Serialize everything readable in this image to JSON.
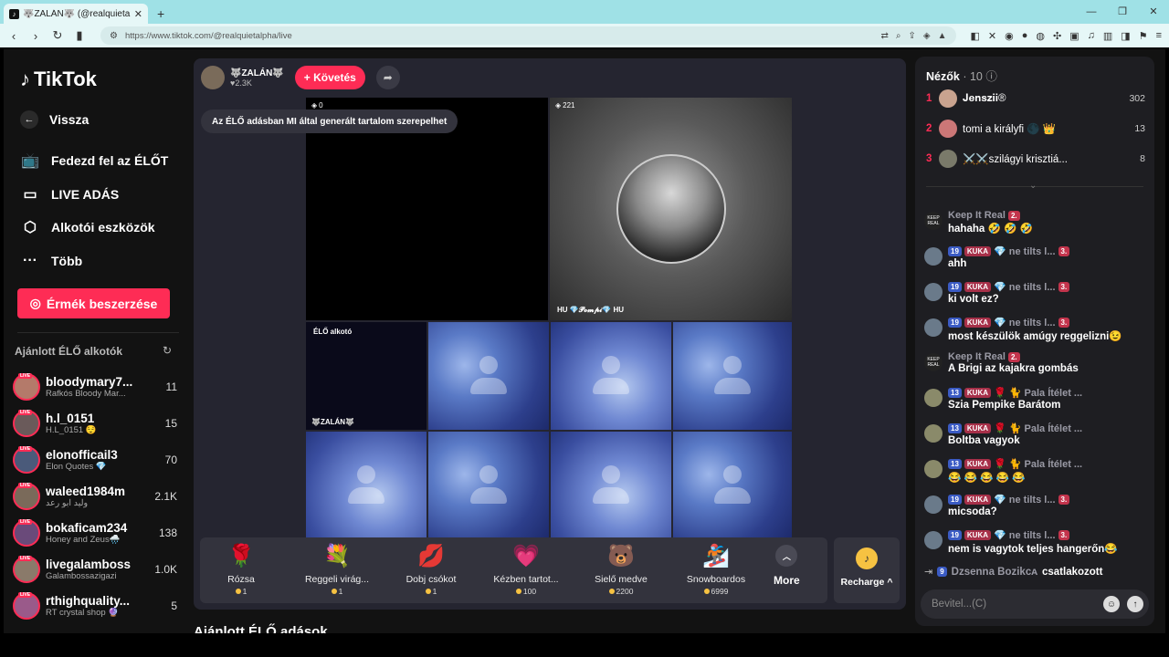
{
  "browser": {
    "tab_title": "🐺ZALÁN🐺 (@realquietalp",
    "url": "https://www.tiktok.com/@realquietalpha/live"
  },
  "sidebar": {
    "logo": "TikTok",
    "back": "Vissza",
    "nav": [
      {
        "label": "Fedezd fel az ÉLŐT",
        "icon": "tv-icon"
      },
      {
        "label": "LIVE ADÁS",
        "icon": "camera-icon"
      },
      {
        "label": "Alkotói eszközök",
        "icon": "creator-tools-icon"
      },
      {
        "label": "Több",
        "icon": "more-dots-icon"
      }
    ],
    "coins_button": "Érmék beszerzése",
    "suggested_title": "Ajánlott ÉLŐ alkotók",
    "live_tag": "LIVE",
    "creators": [
      {
        "username": "bloodymary7...",
        "sub": "Rafkós Bloody Mar...",
        "count": "11"
      },
      {
        "username": "h.l_0151",
        "sub": "H.L_0151 😌",
        "count": "15"
      },
      {
        "username": "elonofficail3",
        "sub": "Elon Quotes 💎",
        "count": "70"
      },
      {
        "username": "waleed1984m",
        "sub": "وليد ابو رعد",
        "count": "2.1K"
      },
      {
        "username": "bokaficam234",
        "sub": "Honey and Zeus🌧️",
        "count": "138"
      },
      {
        "username": "livegalamboss",
        "sub": "Galambossazigazi",
        "count": "1.0K"
      },
      {
        "username": "rthighquality...",
        "sub": "RT crystal shop 🔮",
        "count": "5"
      }
    ]
  },
  "stream": {
    "host_name": "🐺ZALÁN🐺",
    "host_likes": "2.3K",
    "follow_label": "+ Követés",
    "ai_notice": "Az ÉLŐ adásban MI által generált tartalom szerepelhet",
    "cell1_viewers": "0",
    "cell2_viewers": "221",
    "cell2_name": "HU 💎𝓟𝓸𝓶𝓹𝓲💎 HU",
    "creator_label": "ÉLŐ alkotó",
    "host_tile_name": "🐺ZALÁN🐺"
  },
  "gifts": [
    {
      "name": "Rózsa",
      "price": "1",
      "icon": "🌹"
    },
    {
      "name": "Reggeli virág...",
      "price": "1",
      "icon": "💐"
    },
    {
      "name": "Dobj csókot",
      "price": "1",
      "icon": "💋"
    },
    {
      "name": "Kézben tartot...",
      "price": "100",
      "icon": "💗"
    },
    {
      "name": "Sielő medve",
      "price": "2200",
      "icon": "🐻"
    },
    {
      "name": "Snowboardos",
      "price": "6999",
      "icon": "🏂"
    }
  ],
  "more_label": "More",
  "recharge_label": "Recharge ^",
  "below_title": "Ajánlott ÉLŐ adások",
  "chat": {
    "title": "Nézők",
    "viewer_count": "· 10",
    "top_viewers": [
      {
        "rank": "1",
        "name": "𝐉𝐞𝐧𝐬𝐳𝐢𝐢®",
        "score": "302"
      },
      {
        "rank": "2",
        "name": "tomi a királyfi 🌑 👑",
        "score": "13"
      },
      {
        "rank": "3",
        "name": "⚔️⚔️szilágyi krisztiá...",
        "score": "8"
      }
    ],
    "messages": [
      {
        "avatar": "KEEP REAL",
        "meta": "Keep It Real",
        "badges": [
          "2."
        ],
        "text": "hahaha 🤣 🤣 🤣"
      },
      {
        "avatar": "",
        "meta": "💎 ne tilts l...",
        "badges": [
          "19",
          "KUKA",
          "3."
        ],
        "text": "ahh"
      },
      {
        "avatar": "",
        "meta": "💎 ne tilts l...",
        "badges": [
          "19",
          "KUKA",
          "3."
        ],
        "text": "ki volt ez?"
      },
      {
        "avatar": "",
        "meta": "💎 ne tilts l...",
        "badges": [
          "19",
          "KUKA",
          "3."
        ],
        "text": "most készülök amúgy reggelizni😉"
      },
      {
        "avatar": "KEEP REAL",
        "meta": "Keep It Real",
        "badges": [
          "2."
        ],
        "text": "A Brigi az kajakra gombás"
      },
      {
        "avatar": "",
        "meta": "🌹 🐈 Pala Ítélet ...",
        "badges": [
          "13",
          "KUKA"
        ],
        "text": "Szia Pempike Barátom"
      },
      {
        "avatar": "",
        "meta": "🌹 🐈 Pala Ítélet ...",
        "badges": [
          "13",
          "KUKA"
        ],
        "text": "Boltba vagyok"
      },
      {
        "avatar": "",
        "meta": "🌹 🐈 Pala Ítélet ...",
        "badges": [
          "13",
          "KUKA"
        ],
        "text": "😂 😂 😂 😂 😂"
      },
      {
        "avatar": "",
        "meta": "💎 ne tilts l...",
        "badges": [
          "19",
          "KUKA",
          "3."
        ],
        "text": "micsoda?"
      },
      {
        "avatar": "",
        "meta": "💎 ne tilts l...",
        "badges": [
          "19",
          "KUKA",
          "3."
        ],
        "text": "nem is vagytok teljes hangerőn😂"
      }
    ],
    "joined_badge": "9",
    "joined_name": "Dzsenna Bozikᴄᴀ",
    "joined_text": "csatlakozott",
    "input_placeholder": "Bevitel...(C)"
  }
}
